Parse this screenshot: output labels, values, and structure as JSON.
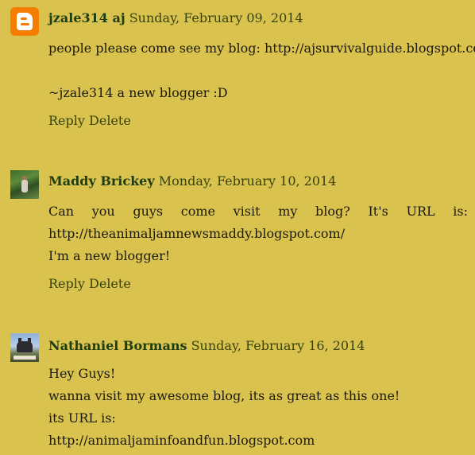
{
  "comments": [
    {
      "author": "jzale314 aj",
      "date": "Sunday, February 09, 2014",
      "avatar_icon": "blogger-icon",
      "lines": [
        "people please come see my blog: http://ajsurvivalguide.blogspot.com/",
        "~jzale314 a new blogger :D"
      ],
      "reply_label": "Reply",
      "delete_label": "Delete"
    },
    {
      "author": "Maddy Brickey",
      "date": "Monday, February 10, 2014",
      "avatar_icon": "user-photo",
      "lines": [
        "Can you guys come visit my blog? It's URL is:",
        "http://theanimaljamnewsmaddy.blogspot.com/",
        "I'm a new blogger!"
      ],
      "reply_label": "Reply",
      "delete_label": "Delete"
    },
    {
      "author": "Nathaniel Bormans",
      "date": "Sunday, February 16, 2014",
      "avatar_icon": "user-photo",
      "lines": [
        "Hey Guys!",
        "wanna visit my awesome blog, its as great as this one!",
        "its URL is:",
        "http://animaljaminfoandfun.blogspot.com"
      ]
    }
  ],
  "colors": {
    "background": "#d9c24d",
    "author": "#1f3d12",
    "link": "#37430f",
    "blogger_orange": "#f57d00"
  }
}
